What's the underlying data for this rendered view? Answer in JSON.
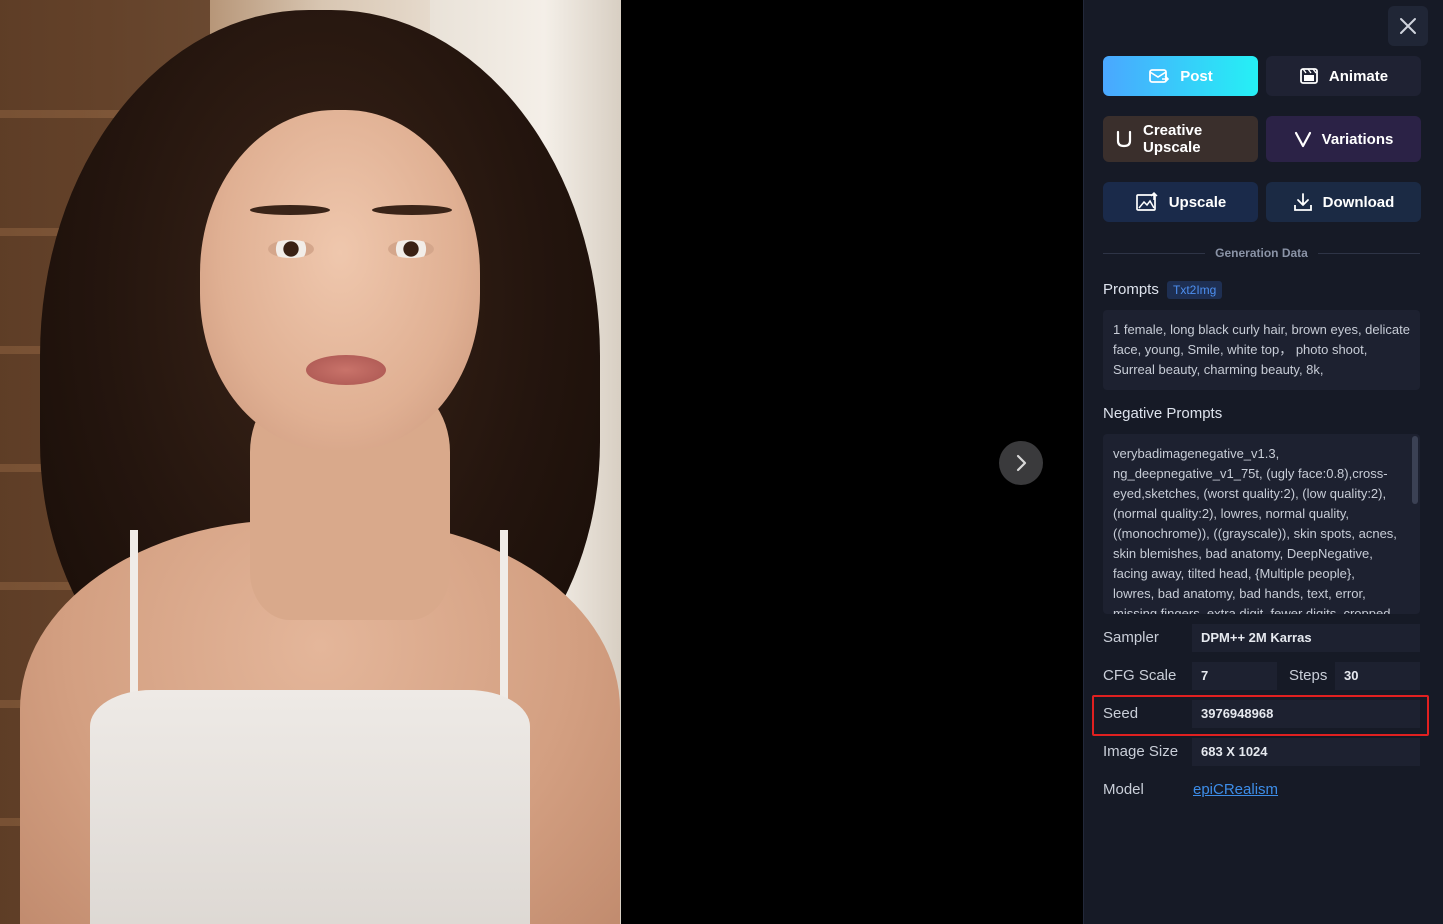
{
  "viewer": {
    "next_icon": "chevron-right-icon",
    "close_icon": "close-icon"
  },
  "actions": {
    "post": "Post",
    "animate": "Animate",
    "creative_upscale_line1": "Creative",
    "creative_upscale_line2": "Upscale",
    "variations": "Variations",
    "upscale": "Upscale",
    "download": "Download"
  },
  "generation": {
    "section_title": "Generation Data",
    "prompts_label": "Prompts",
    "prompt_tag": "Txt2Img",
    "prompt": "1 female, long black curly hair, brown eyes, delicate face, young, Smile, white top， photo shoot, Surreal beauty, charming beauty, 8k,",
    "negative_label": "Negative Prompts",
    "negative_prompt": "verybadimagenegative_v1.3, ng_deepnegative_v1_75t, (ugly face:0.8),cross-eyed,sketches, (worst quality:2), (low quality:2), (normal quality:2), lowres, normal quality, ((monochrome)), ((grayscale)), skin spots, acnes, skin blemishes, bad anatomy, DeepNegative, facing away, tilted head, {Multiple people}, lowres, bad anatomy, bad hands, text, error, missing fingers, extra digit, fewer digits, cropped",
    "sampler_label": "Sampler",
    "sampler": "DPM++ 2M Karras",
    "cfg_label": "CFG Scale",
    "cfg": "7",
    "steps_label": "Steps",
    "steps": "30",
    "seed_label": "Seed",
    "seed": "3976948968",
    "size_label": "Image Size",
    "size": "683 X 1024",
    "model_label": "Model",
    "model": "epiCRealism"
  },
  "colors": {
    "panel_bg": "#161a26",
    "post_gradient": [
      "#4aa7ff",
      "#25f0f5"
    ],
    "link": "#3d8de8",
    "highlight": "#e02020"
  }
}
